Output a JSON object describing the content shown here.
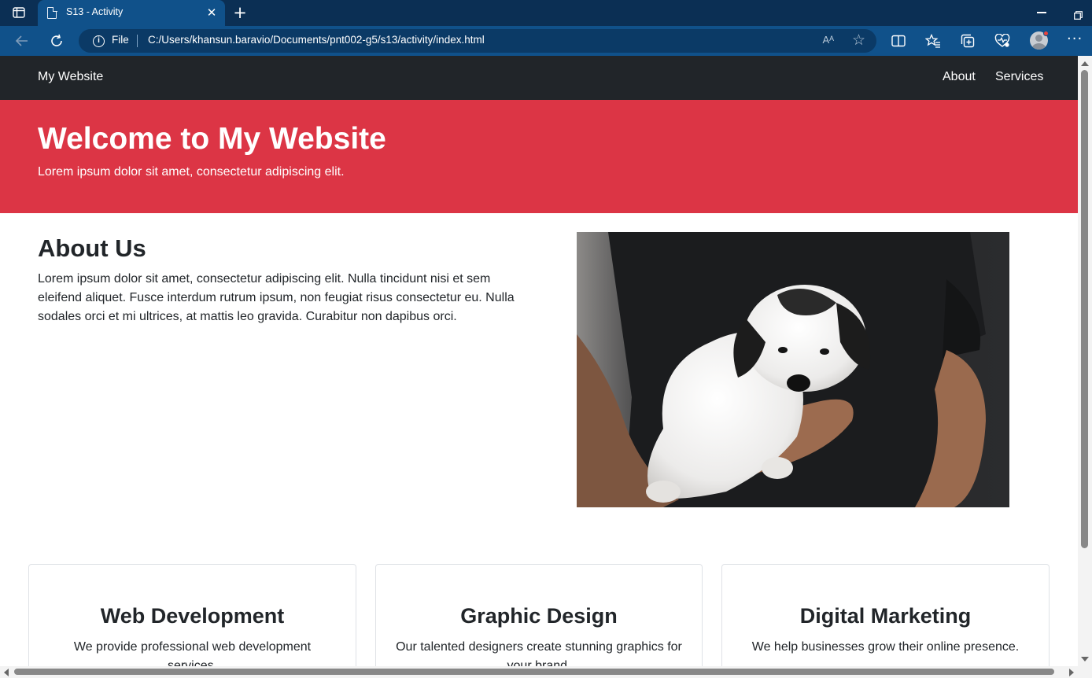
{
  "browser": {
    "tab_title": "S13 - Activity",
    "close_glyph": "✕",
    "newtab_glyph": "+",
    "file_label": "File",
    "url": "C:/Users/khansun.baravio/Documents/pnt002-g5/s13/activity/index.html",
    "read_aloud_glyph": "Aᴬ",
    "favorite_glyph": "☆",
    "more_glyph": "···",
    "info_glyph": "i",
    "icons": [
      "tab-actions-icon",
      "back-icon",
      "refresh-icon",
      "info-icon",
      "read-aloud-icon",
      "star-icon",
      "split-screen-icon",
      "favorites-icon",
      "collections-icon",
      "browser-essentials-icon",
      "profile-avatar",
      "more-icon",
      "minimize-icon",
      "restore-icon"
    ]
  },
  "site": {
    "brand": "My Website",
    "nav": {
      "about": "About",
      "services": "Services"
    },
    "hero": {
      "title": "Welcome to My Website",
      "subtitle": "Lorem ipsum dolor sit amet, consectetur adipiscing elit."
    },
    "about": {
      "title": "About Us",
      "text": "Lorem ipsum dolor sit amet, consectetur adipiscing elit. Nulla tincidunt nisi et sem eleifend aliquet. Fusce interdum rutrum ipsum, non feugiat risus consectetur eu. Nulla sodales orci et mi ultrices, at mattis leo gravida. Curabitur non dapibus orci."
    },
    "cards": [
      {
        "title": "Web Development",
        "text": "We provide professional web development services."
      },
      {
        "title": "Graphic Design",
        "text": "Our talented designers create stunning graphics for your brand."
      },
      {
        "title": "Digital Marketing",
        "text": "We help businesses grow their online presence."
      }
    ]
  },
  "colors": {
    "navbar": "#212529",
    "hero": "#dc3545",
    "browser_tabbar": "#0b2f54",
    "browser_toolbar": "#10518a"
  }
}
